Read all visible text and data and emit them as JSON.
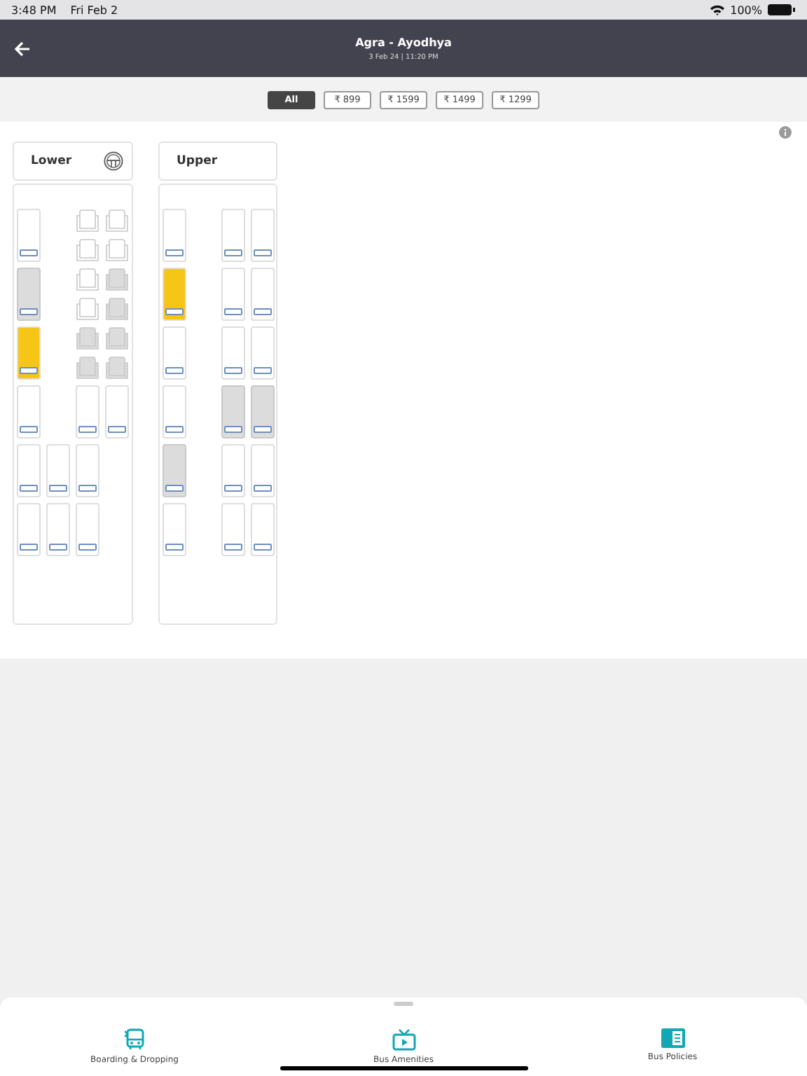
{
  "status_bar": {
    "time": "3:48 PM",
    "date": "Fri Feb 2",
    "battery": "100%"
  },
  "header": {
    "title": "Agra - Ayodhya",
    "subtitle": "3 Feb 24 | 11:20 PM"
  },
  "filters": [
    {
      "label": "All",
      "selected": true
    },
    {
      "label": "₹ 899",
      "selected": false
    },
    {
      "label": "₹ 1599",
      "selected": false
    },
    {
      "label": "₹ 1499",
      "selected": false
    },
    {
      "label": "₹ 1299",
      "selected": false
    }
  ],
  "decks": [
    {
      "name": "Lower",
      "driver": true,
      "rows": [
        [
          {
            "kind": "sleeper",
            "booked": false,
            "ladies": false
          },
          null,
          {
            "kind": "seats",
            "seats": [
              {
                "booked": false
              },
              {
                "booked": false
              }
            ]
          },
          {
            "kind": "seats",
            "seats": [
              {
                "booked": false
              },
              {
                "booked": false
              }
            ]
          }
        ],
        [
          {
            "kind": "sleeper",
            "booked": true,
            "ladies": false
          },
          null,
          {
            "kind": "seats",
            "seats": [
              {
                "booked": false
              },
              {
                "booked": false
              }
            ]
          },
          {
            "kind": "seats",
            "seats": [
              {
                "booked": true
              },
              {
                "booked": true
              }
            ]
          }
        ],
        [
          {
            "kind": "sleeper",
            "booked": false,
            "ladies": true
          },
          null,
          {
            "kind": "seats",
            "seats": [
              {
                "booked": true
              },
              {
                "booked": true
              }
            ]
          },
          {
            "kind": "seats",
            "seats": [
              {
                "booked": true
              },
              {
                "booked": true
              }
            ]
          }
        ],
        [
          {
            "kind": "sleeper",
            "booked": false,
            "ladies": false
          },
          null,
          {
            "kind": "sleeper",
            "booked": false,
            "ladies": false
          },
          {
            "kind": "sleeper",
            "booked": false,
            "ladies": false
          }
        ],
        [
          {
            "kind": "sleeper",
            "booked": false,
            "ladies": false
          },
          {
            "kind": "sleeper",
            "booked": false,
            "ladies": false
          },
          {
            "kind": "sleeper",
            "booked": false,
            "ladies": false
          },
          null
        ],
        [
          {
            "kind": "sleeper",
            "booked": false,
            "ladies": false
          },
          {
            "kind": "sleeper",
            "booked": false,
            "ladies": false
          },
          {
            "kind": "sleeper",
            "booked": false,
            "ladies": false
          },
          null
        ]
      ]
    },
    {
      "name": "Upper",
      "driver": false,
      "rows": [
        [
          {
            "kind": "sleeper",
            "booked": false,
            "ladies": false
          },
          null,
          {
            "kind": "sleeper",
            "booked": false,
            "ladies": false
          },
          {
            "kind": "sleeper",
            "booked": false,
            "ladies": false
          }
        ],
        [
          {
            "kind": "sleeper",
            "booked": false,
            "ladies": true
          },
          null,
          {
            "kind": "sleeper",
            "booked": false,
            "ladies": false
          },
          {
            "kind": "sleeper",
            "booked": false,
            "ladies": false
          }
        ],
        [
          {
            "kind": "sleeper",
            "booked": false,
            "ladies": false
          },
          null,
          {
            "kind": "sleeper",
            "booked": false,
            "ladies": false
          },
          {
            "kind": "sleeper",
            "booked": false,
            "ladies": false
          }
        ],
        [
          {
            "kind": "sleeper",
            "booked": false,
            "ladies": false
          },
          null,
          {
            "kind": "sleeper",
            "booked": true,
            "ladies": false
          },
          {
            "kind": "sleeper",
            "booked": true,
            "ladies": false
          }
        ],
        [
          {
            "kind": "sleeper",
            "booked": true,
            "ladies": false
          },
          null,
          {
            "kind": "sleeper",
            "booked": false,
            "ladies": false
          },
          {
            "kind": "sleeper",
            "booked": false,
            "ladies": false
          }
        ],
        [
          {
            "kind": "sleeper",
            "booked": false,
            "ladies": false
          },
          null,
          {
            "kind": "sleeper",
            "booked": false,
            "ladies": false
          },
          {
            "kind": "sleeper",
            "booked": false,
            "ladies": false
          }
        ]
      ]
    }
  ],
  "bottom_tabs": [
    {
      "label": "Boarding & Dropping",
      "kind": "bus"
    },
    {
      "label": "Bus Amenities",
      "kind": "tv"
    },
    {
      "label": "Bus Policies",
      "kind": "book"
    }
  ]
}
